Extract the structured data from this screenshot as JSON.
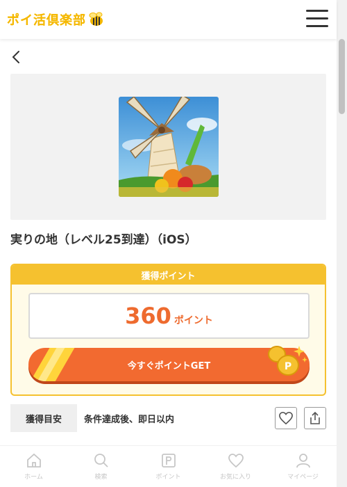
{
  "header": {
    "logo_text": "ポイ活倶楽部"
  },
  "app": {
    "title": "実りの地（レベル25到達）（iOS）"
  },
  "point_card": {
    "heading": "獲得ポイント",
    "value": "360",
    "unit": "ポイント",
    "get_button_label": "今すぐポイントGET"
  },
  "info": {
    "label": "獲得目安",
    "value": "条件達成後、即日以内"
  },
  "bottom_nav": [
    {
      "label": "ホーム",
      "icon": "home-icon"
    },
    {
      "label": "検索",
      "icon": "search-icon"
    },
    {
      "label": "ポイント",
      "icon": "point-icon"
    },
    {
      "label": "お気に入り",
      "icon": "heart-icon"
    },
    {
      "label": "マイページ",
      "icon": "user-icon"
    }
  ],
  "colors": {
    "brand_yellow": "#f5c12f",
    "accent_orange": "#f26a30",
    "point_text": "#ee6b2f"
  }
}
